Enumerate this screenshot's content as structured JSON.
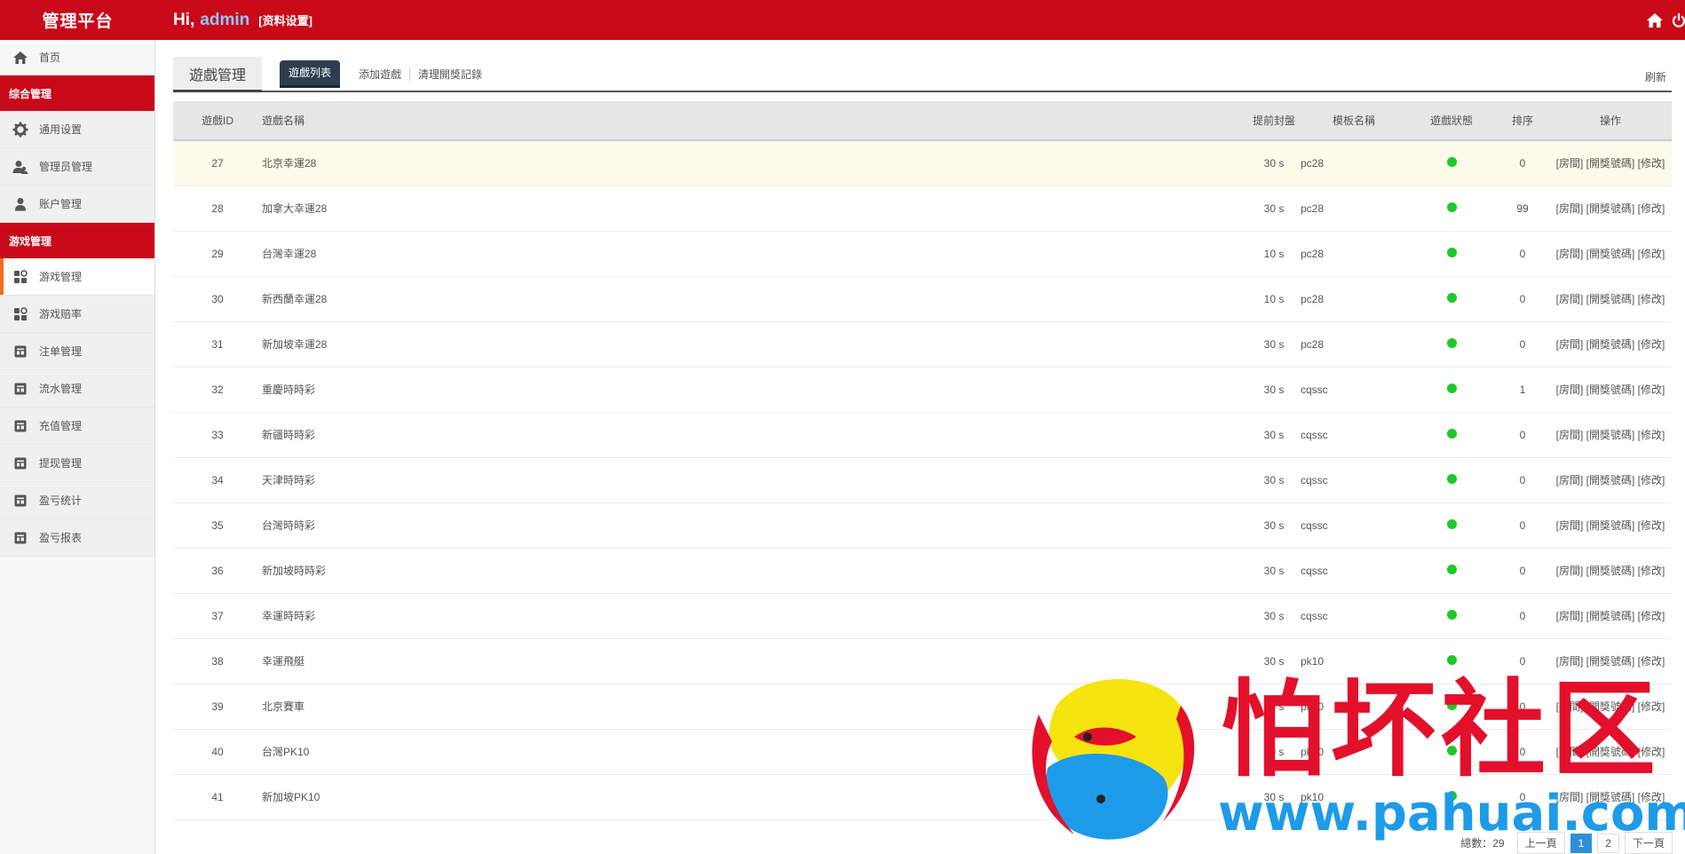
{
  "header": {
    "brand": "管理平台",
    "greeting": "Hi,",
    "username": "admin",
    "profile_link": "[资料设置]"
  },
  "sidebar": {
    "home": "首页",
    "groups": [
      {
        "title": "综合管理",
        "items": [
          "通用设置",
          "管理员管理",
          "账户管理"
        ]
      },
      {
        "title": "游戏管理",
        "items": [
          "游戏管理",
          "游戏赔率",
          "注单管理",
          "流水管理",
          "充值管理",
          "提现管理",
          "盈亏统计",
          "盈亏报表"
        ]
      }
    ]
  },
  "main": {
    "page_tab": "遊戲管理",
    "subtabs": [
      "遊戲列表",
      "添加遊戲",
      "清理開獎記錄"
    ],
    "refresh": "刷新",
    "columns": [
      "遊戲ID",
      "遊戲名稱",
      "提前封盤",
      "模板名稱",
      "遊戲狀態",
      "排序",
      "操作"
    ],
    "ops": [
      "[房間]",
      "[開獎號碼]",
      "[修改]"
    ],
    "rows": [
      {
        "id": "27",
        "name": "北京幸運28",
        "close": "30 s",
        "tpl": "pc28",
        "sort": "0"
      },
      {
        "id": "28",
        "name": "加拿大幸運28",
        "close": "30 s",
        "tpl": "pc28",
        "sort": "99"
      },
      {
        "id": "29",
        "name": "台灣幸運28",
        "close": "10 s",
        "tpl": "pc28",
        "sort": "0"
      },
      {
        "id": "30",
        "name": "新西蘭幸運28",
        "close": "10 s",
        "tpl": "pc28",
        "sort": "0"
      },
      {
        "id": "31",
        "name": "新加坡幸運28",
        "close": "30 s",
        "tpl": "pc28",
        "sort": "0"
      },
      {
        "id": "32",
        "name": "重慶時時彩",
        "close": "30 s",
        "tpl": "cqssc",
        "sort": "1"
      },
      {
        "id": "33",
        "name": "新疆時時彩",
        "close": "30 s",
        "tpl": "cqssc",
        "sort": "0"
      },
      {
        "id": "34",
        "name": "天津時時彩",
        "close": "30 s",
        "tpl": "cqssc",
        "sort": "0"
      },
      {
        "id": "35",
        "name": "台灣時時彩",
        "close": "30 s",
        "tpl": "cqssc",
        "sort": "0"
      },
      {
        "id": "36",
        "name": "新加坡時時彩",
        "close": "30 s",
        "tpl": "cqssc",
        "sort": "0"
      },
      {
        "id": "37",
        "name": "幸運時時彩",
        "close": "30 s",
        "tpl": "cqssc",
        "sort": "0"
      },
      {
        "id": "38",
        "name": "幸運飛艇",
        "close": "30 s",
        "tpl": "pk10",
        "sort": "0"
      },
      {
        "id": "39",
        "name": "北京賽車",
        "close": "30 s",
        "tpl": "pk10",
        "sort": "0"
      },
      {
        "id": "40",
        "name": "台灣PK10",
        "close": "30 s",
        "tpl": "pk10",
        "sort": "0"
      },
      {
        "id": "41",
        "name": "新加坡PK10",
        "close": "30 s",
        "tpl": "pk10",
        "sort": "0"
      }
    ]
  },
  "pager": {
    "total": "總數：29",
    "prev": "上一頁",
    "pages": [
      "1",
      "2"
    ],
    "next": "下一頁"
  },
  "watermark": {
    "cn": "怕坏社区",
    "url": "www.pahuai.com"
  },
  "colors": {
    "brand_red": "#c8091a",
    "status_green": "#1dc928",
    "tab_dark": "#2d3e50",
    "active_bar": "#f26b1d"
  },
  "icons": {
    "home": "home-icon",
    "power": "power-icon",
    "gear": "gear-icon",
    "users": "users-icon",
    "user": "user-icon",
    "grid": "apps-icon",
    "ledger": "ledger-icon"
  }
}
